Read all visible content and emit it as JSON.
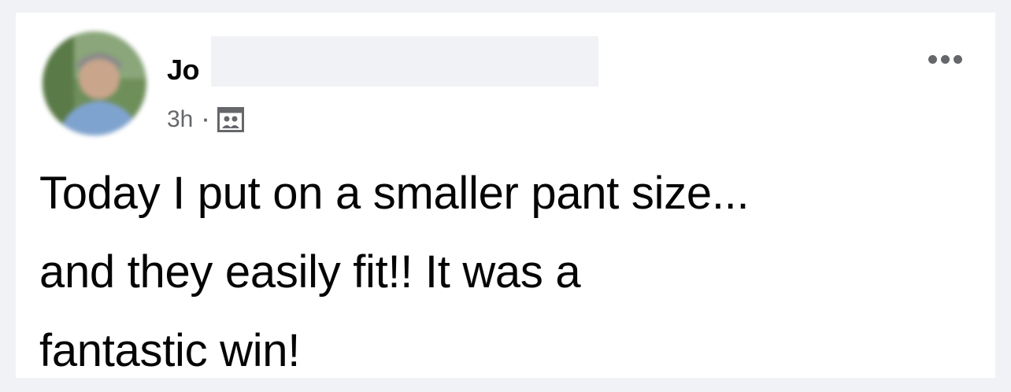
{
  "post": {
    "author_name": "Jo",
    "timestamp": "3h",
    "separator": "·",
    "audience_icon": "friends-icon",
    "more_icon": "more-options-icon",
    "text": "Today I put on a smaller pant size...\nand they easily fit!! It was a\nfantastic win!"
  },
  "colors": {
    "page_background": "#f0f2f5",
    "card_background": "#ffffff",
    "primary_text": "#050505",
    "secondary_text": "#65676b"
  }
}
